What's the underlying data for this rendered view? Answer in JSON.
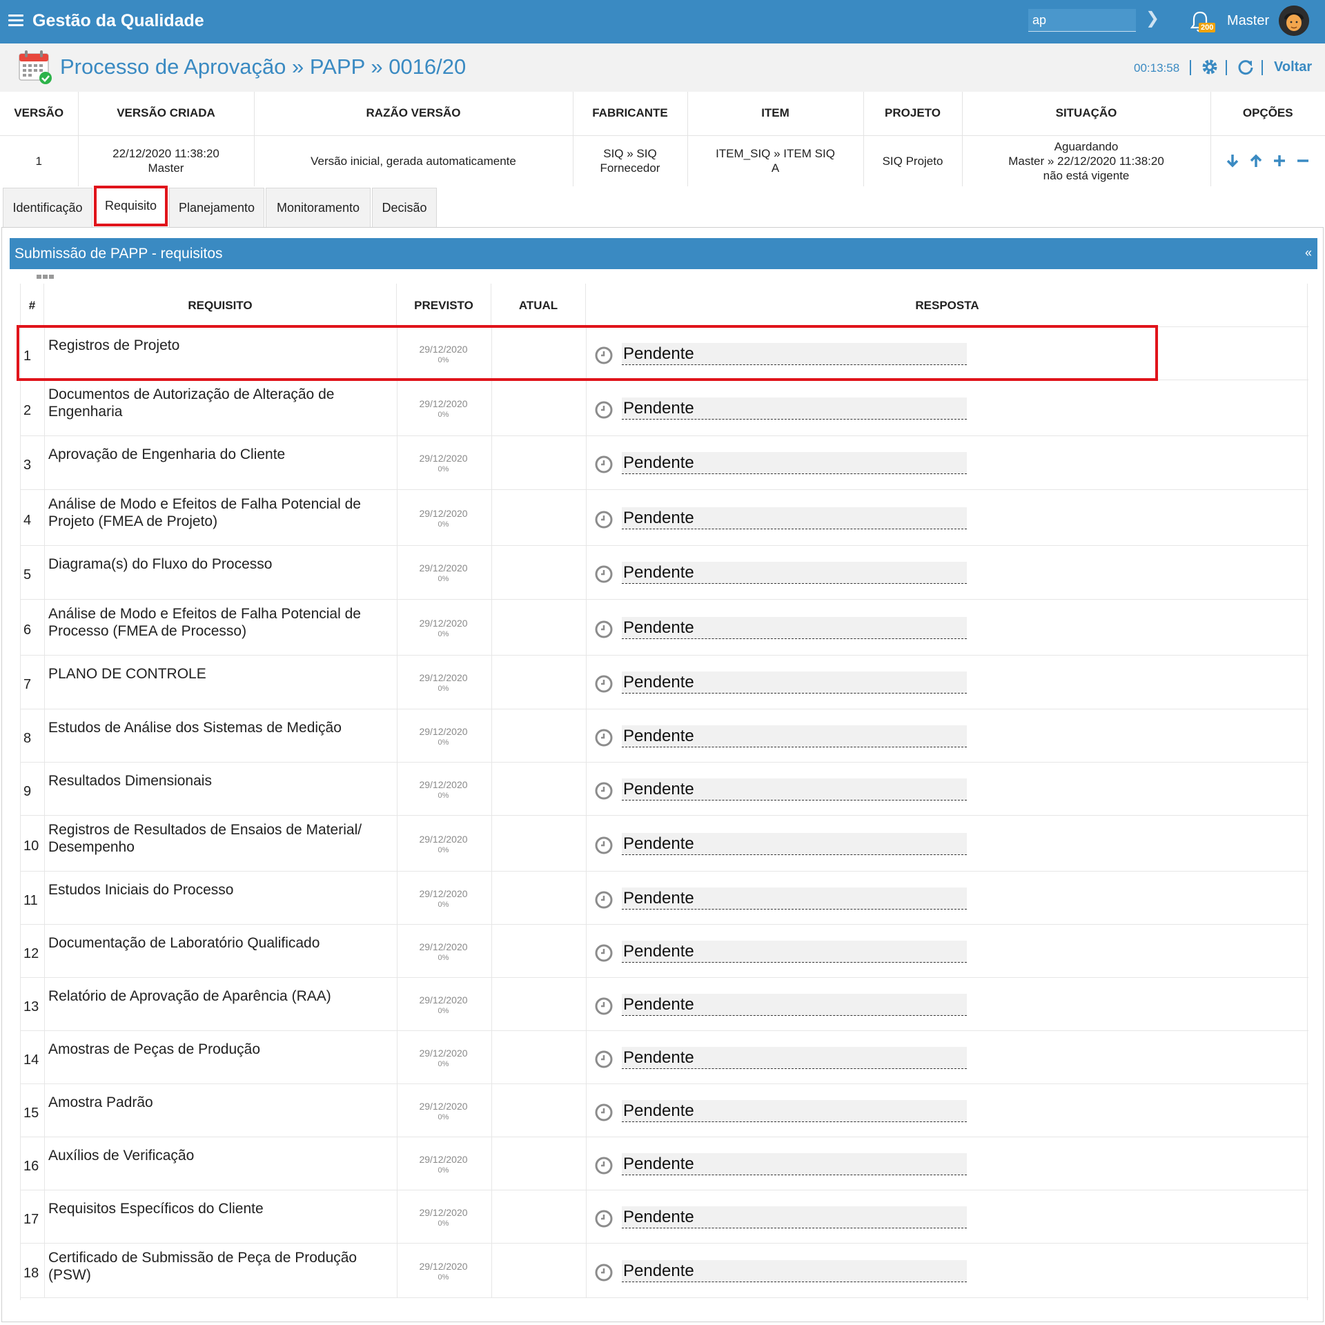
{
  "app": {
    "title": "Gestão da Qualidade",
    "search_value": "ap",
    "notification_count": "200",
    "user_name": "Master"
  },
  "header": {
    "title": "Processo de Aprovação » PAPP » 0016/20",
    "timer": "00:13:58",
    "back_label": "Voltar"
  },
  "version_table": {
    "columns": [
      "VERSÃO",
      "VERSÃO CRIADA",
      "RAZÃO VERSÃO",
      "FABRICANTE",
      "ITEM",
      "PROJETO",
      "SITUAÇÃO",
      "OPÇÕES"
    ],
    "row": {
      "version": "1",
      "created_date": "22/12/2020 11:38:20",
      "created_by": "Master",
      "reason": "Versão inicial, gerada automaticamente",
      "manufacturer_line1": "SIQ » SIQ",
      "manufacturer_line2": "Fornecedor",
      "item_line1": "ITEM_SIQ » ITEM SIQ",
      "item_line2": "A",
      "project": "SIQ Projeto",
      "status_line1": "Aguardando",
      "status_line2": "Master » 22/12/2020 11:38:20",
      "status_line3": "não está vigente"
    }
  },
  "tabs": [
    "Identificação",
    "Requisito",
    "Planejamento",
    "Monitoramento",
    "Decisão"
  ],
  "active_tab": "Requisito",
  "panel": {
    "title": "Submissão de PAPP - requisitos",
    "collapse": "«"
  },
  "requirements": {
    "columns": [
      "#",
      "REQUISITO",
      "PREVISTO",
      "ATUAL",
      "RESPOSTA"
    ],
    "rows": [
      {
        "num": "1",
        "req": "Registros de Projeto",
        "date": "29/12/2020",
        "pct": "0%",
        "resp": "Pendente"
      },
      {
        "num": "2",
        "req": "Documentos de Autorização de Alteração de Engenharia",
        "date": "29/12/2020",
        "pct": "0%",
        "resp": "Pendente"
      },
      {
        "num": "3",
        "req": "Aprovação de Engenharia do Cliente",
        "date": "29/12/2020",
        "pct": "0%",
        "resp": "Pendente"
      },
      {
        "num": "4",
        "req": "Análise de Modo e Efeitos de Falha Potencial de Projeto (FMEA de Projeto)",
        "date": "29/12/2020",
        "pct": "0%",
        "resp": "Pendente"
      },
      {
        "num": "5",
        "req": "Diagrama(s) do Fluxo do Processo",
        "date": "29/12/2020",
        "pct": "0%",
        "resp": "Pendente"
      },
      {
        "num": "6",
        "req": "Análise de Modo e Efeitos de Falha Potencial de Processo (FMEA de Processo)",
        "date": "29/12/2020",
        "pct": "0%",
        "resp": "Pendente"
      },
      {
        "num": "7",
        "req": "PLANO DE CONTROLE",
        "date": "29/12/2020",
        "pct": "0%",
        "resp": "Pendente"
      },
      {
        "num": "8",
        "req": "Estudos de Análise dos Sistemas de Medição",
        "date": "29/12/2020",
        "pct": "0%",
        "resp": "Pendente"
      },
      {
        "num": "9",
        "req": "Resultados Dimensionais",
        "date": "29/12/2020",
        "pct": "0%",
        "resp": "Pendente"
      },
      {
        "num": "10",
        "req": "Registros de Resultados de Ensaios de Material/ Desempenho",
        "date": "29/12/2020",
        "pct": "0%",
        "resp": "Pendente"
      },
      {
        "num": "11",
        "req": "Estudos Iniciais do Processo",
        "date": "29/12/2020",
        "pct": "0%",
        "resp": "Pendente"
      },
      {
        "num": "12",
        "req": "Documentação de Laboratório Qualificado",
        "date": "29/12/2020",
        "pct": "0%",
        "resp": "Pendente"
      },
      {
        "num": "13",
        "req": "Relatório de Aprovação de Aparência (RAA)",
        "date": "29/12/2020",
        "pct": "0%",
        "resp": "Pendente"
      },
      {
        "num": "14",
        "req": "Amostras de Peças de Produção",
        "date": "29/12/2020",
        "pct": "0%",
        "resp": "Pendente"
      },
      {
        "num": "15",
        "req": "Amostra Padrão",
        "date": "29/12/2020",
        "pct": "0%",
        "resp": "Pendente"
      },
      {
        "num": "16",
        "req": "Auxílios de Verificação",
        "date": "29/12/2020",
        "pct": "0%",
        "resp": "Pendente"
      },
      {
        "num": "17",
        "req": "Requisitos Específicos do Cliente",
        "date": "29/12/2020",
        "pct": "0%",
        "resp": "Pendente"
      },
      {
        "num": "18",
        "req": "Certificado de Submissão de Peça de Produção (PSW)",
        "date": "29/12/2020",
        "pct": "0%",
        "resp": "Pendente"
      }
    ]
  },
  "colors": {
    "brand": "#3a8ac2",
    "highlight": "#e0141b",
    "badge": "#f0a30a"
  }
}
